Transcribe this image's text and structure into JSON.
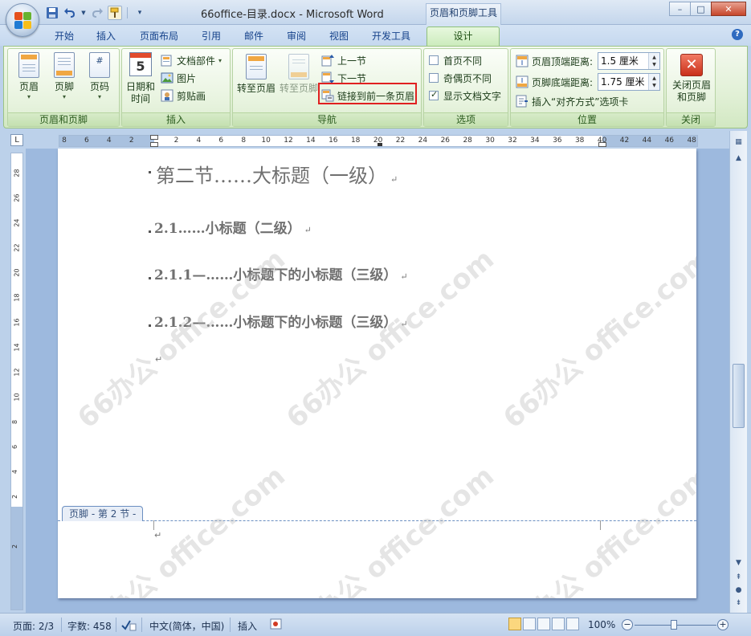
{
  "window": {
    "title": "66office-目录.docx - Microsoft Word",
    "context_tab": "页眉和页脚工具",
    "controls": [
      "–",
      "□",
      "✕"
    ]
  },
  "quick_access": {
    "icons": [
      "save-icon",
      "undo-icon",
      "redo-icon",
      "paint-format-icon",
      "customize-qat-icon"
    ]
  },
  "tabs": [
    {
      "label": "开始"
    },
    {
      "label": "插入"
    },
    {
      "label": "页面布局"
    },
    {
      "label": "引用"
    },
    {
      "label": "邮件"
    },
    {
      "label": "审阅"
    },
    {
      "label": "视图"
    },
    {
      "label": "开发工具"
    },
    {
      "label": "设计"
    }
  ],
  "ribbon": {
    "header_footer_group": {
      "label": "页眉和页脚",
      "header": "页眉",
      "footer": "页脚",
      "page_number": "页码"
    },
    "insert_group": {
      "label": "插入",
      "datetime": "日期和\n时间",
      "doc_parts": "文档部件",
      "picture": "图片",
      "clipart": "剪贴画"
    },
    "nav_group": {
      "label": "导航",
      "goto_header": "转至页眉",
      "goto_footer": "转至页脚",
      "prev_section": "上一节",
      "next_section": "下一节",
      "link_previous": "链接到前一条页眉"
    },
    "options_group": {
      "label": "选项",
      "diff_first": "首页不同",
      "diff_odd_even": "奇偶页不同",
      "show_doc_text": "显示文档文字"
    },
    "position_group": {
      "label": "位置",
      "header_top_label": "页眉顶端距离:",
      "header_top_value": "1.5 厘米",
      "footer_bottom_label": "页脚底端距离:",
      "footer_bottom_value": "1.75 厘米",
      "insert_align_tab": "插入“对齐方式”选项卡"
    },
    "close_group": {
      "label": "关闭",
      "close_hf": "关闭页眉\n和页脚"
    }
  },
  "ruler": {
    "ticks": [
      "8",
      "6",
      "4",
      "2",
      "",
      "2",
      "4",
      "6",
      "8",
      "10",
      "12",
      "14",
      "16",
      "18",
      "20",
      "22",
      "24",
      "26",
      "28",
      "30",
      "32",
      "34",
      "36",
      "38",
      "40",
      "42",
      "44",
      "46",
      "48"
    ],
    "vticks": [
      "28",
      "26",
      "24",
      "22",
      "20",
      "18",
      "16",
      "14",
      "12",
      "10",
      "8",
      "6",
      "4",
      "2",
      "",
      "2"
    ]
  },
  "document": {
    "h1": "第二节……大标题（一级）",
    "h2": "2.1……小标题（二级）",
    "h3a": "2.1.1—……小标题下的小标题（三级）",
    "h3b": "2.1.2—……小标题下的小标题（三级）",
    "para_mark": "↵",
    "footer_tag": "页脚 - 第 2 节 -",
    "watermark": "66办公 office.com"
  },
  "statusbar": {
    "page": "页面: 2/3",
    "words": "字数: 458",
    "language": "中文(简体，中国)",
    "mode": "插入",
    "zoom": "100%"
  }
}
